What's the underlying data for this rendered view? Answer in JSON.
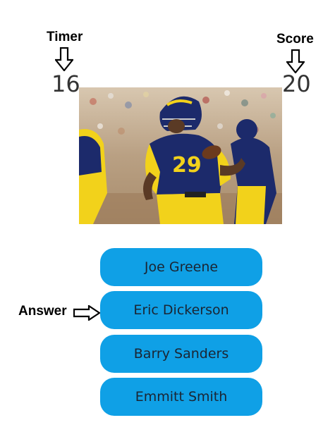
{
  "annotations": {
    "timer_label": "Timer",
    "score_label": "Score",
    "answer_label": "Answer"
  },
  "game": {
    "timer_value": "16",
    "score_value": "20"
  },
  "photo": {
    "subject": "football-player-running-with-ball",
    "jersey_number": "29"
  },
  "answers": [
    {
      "label": "Joe Greene"
    },
    {
      "label": "Eric Dickerson"
    },
    {
      "label": "Barry Sanders"
    },
    {
      "label": "Emmitt Smith"
    }
  ],
  "colors": {
    "button": "#0fa0e6",
    "button_text": "#1b2533",
    "number_text": "#333333",
    "jersey_blue": "#1c2a6b",
    "jersey_yellow": "#f2d21b"
  }
}
